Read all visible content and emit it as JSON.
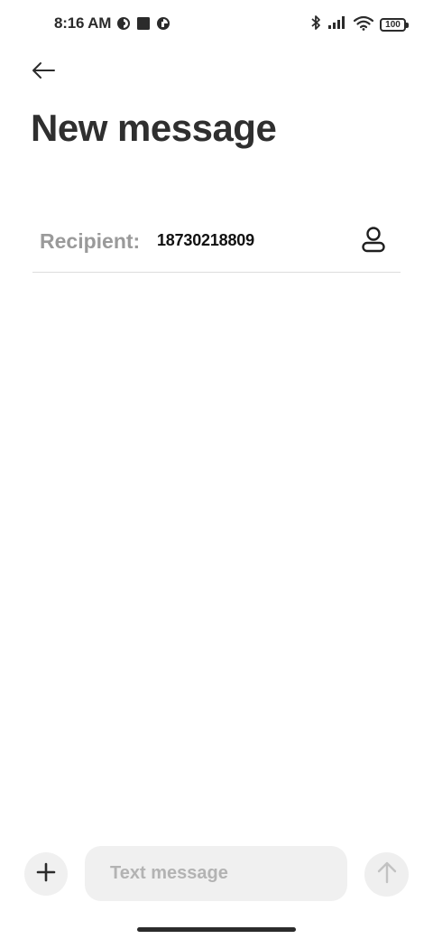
{
  "status_bar": {
    "time": "8:16 AM",
    "battery_level": "100",
    "icons": [
      "notification-dot-icon",
      "stop-square-icon",
      "notification-dot-icon",
      "bluetooth-icon",
      "signal-icon",
      "wifi-icon",
      "battery-icon"
    ]
  },
  "header": {
    "back_icon": "arrow-left-icon",
    "title": "New message"
  },
  "recipient": {
    "label": "Recipient:",
    "value": "18730218809",
    "contact_icon": "person-icon"
  },
  "composer": {
    "add_icon": "plus-icon",
    "placeholder": "Text message",
    "send_icon": "arrow-up-icon"
  },
  "colors": {
    "text_primary": "#2f2f2f",
    "label_gray": "#9a9a9a",
    "input_bg": "#f0f0f0",
    "divider": "#dcdcdc"
  }
}
